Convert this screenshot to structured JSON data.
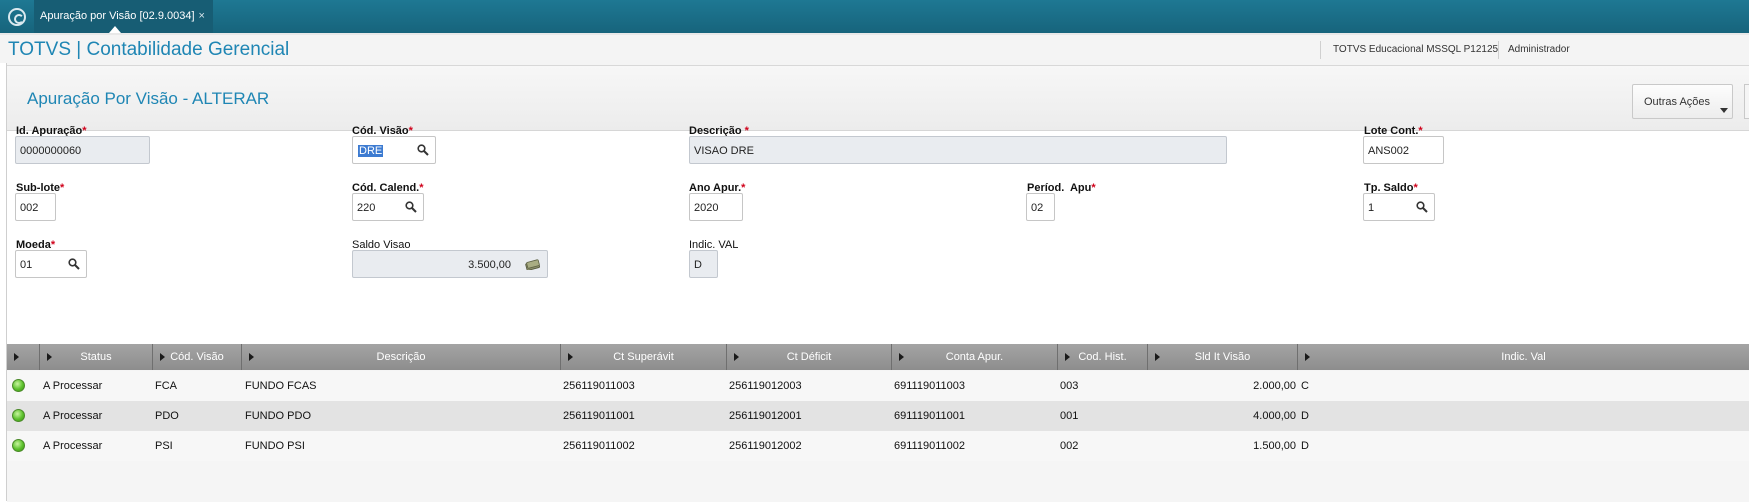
{
  "topbar": {
    "tab_label": "Apuração por Visão [02.9.0034]",
    "tab_close": "×"
  },
  "header": {
    "brand": "TOTVS | Contabilidade Gerencial",
    "environment": "TOTVS Educacional MSSQL P12125",
    "user": "Administrador"
  },
  "page": {
    "title": "Apuração Por Visão - ALTERAR",
    "actions_button": "Outras Ações"
  },
  "form": {
    "id_apuracao": {
      "label": "Id. Apuração",
      "value": "0000000060"
    },
    "cod_visao": {
      "label": "Cód. Visão",
      "value": "DRE"
    },
    "descricao": {
      "label": "Descrição ",
      "value": "VISAO DRE"
    },
    "lote_cont": {
      "label": "Lote Cont.",
      "value": "ANS002"
    },
    "sub_lote": {
      "label": "Sub-lote",
      "value": "002"
    },
    "cod_calend": {
      "label": "Cód. Calend.",
      "value": "220"
    },
    "ano_apur": {
      "label": "Ano Apur.",
      "value": "2020"
    },
    "period_apu": {
      "label": "Períod.  Apu",
      "value": "02"
    },
    "tp_saldo": {
      "label": "Tp. Saldo",
      "value": "1"
    },
    "moeda": {
      "label": "Moeda",
      "value": "01"
    },
    "saldo_visao": {
      "label": "Saldo Visao",
      "value": "3.500,00"
    },
    "indic_val": {
      "label": "Indic. VAL",
      "value": "D"
    },
    "required_mark": "*"
  },
  "grid": {
    "columns": [
      "Status",
      "Cód. Visão",
      "Descrição",
      "Ct Superávit",
      "Ct Déficit",
      "Conta Apur.",
      "Cod. Hist.",
      "Sld It Visão",
      "Indic. Val"
    ],
    "rows": [
      {
        "status": "A Processar",
        "cod_visao": "FCA",
        "descricao": "FUNDO FCAS",
        "ct_superavit": "256119011003",
        "ct_deficit": "256119012003",
        "conta_apur": "691119011003",
        "cod_hist": "003",
        "sld": "2.000,00",
        "indic": "C"
      },
      {
        "status": "A Processar",
        "cod_visao": "PDO",
        "descricao": "FUNDO PDO",
        "ct_superavit": "256119011001",
        "ct_deficit": "256119012001",
        "conta_apur": "691119011001",
        "cod_hist": "001",
        "sld": "4.000,00",
        "indic": "D"
      },
      {
        "status": "A Processar",
        "cod_visao": "PSI",
        "descricao": "FUNDO PSI",
        "ct_superavit": "256119011002",
        "ct_deficit": "256119012002",
        "conta_apur": "691119011002",
        "cod_hist": "002",
        "sld": "1.500,00",
        "indic": "D"
      }
    ]
  },
  "colors": {
    "accent": "#1f86b4",
    "topbar": "#1b6d88",
    "required": "#d0021b",
    "status_ok": "#5cc12c"
  }
}
